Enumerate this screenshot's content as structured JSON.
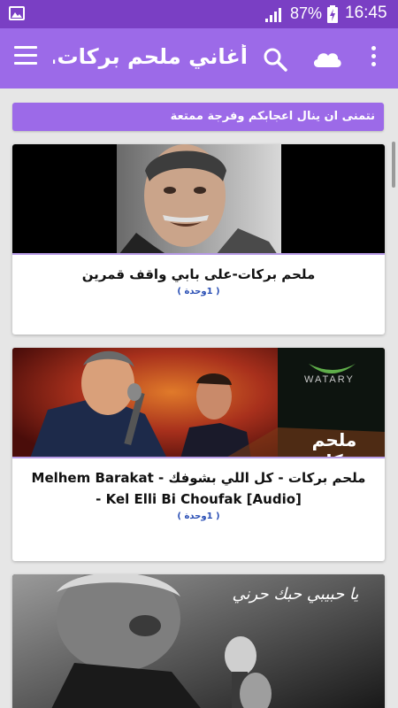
{
  "status_bar": {
    "battery_percent": "87%",
    "time": "16:45",
    "icons": [
      "gallery-icon",
      "signal-icon",
      "battery-charging-icon"
    ]
  },
  "app_bar": {
    "title": "أغاني ملحم بركات...",
    "icons": [
      "menu-icon",
      "search-icon",
      "cloud-icon",
      "more-vert-icon"
    ]
  },
  "banner": {
    "text": "نتمنى ان ينال اعجابكم وفرجة ممتعة"
  },
  "cards": [
    {
      "title": "ملحم بركات-على بابي واقف قمرين",
      "unit": "( 1وحدة )"
    },
    {
      "title": "ملحم بركات - كل اللي بشوفك Melhem Barakat - Kel Elli Bi Choufak [Audio] -",
      "unit": "( 1وحدة )",
      "thumb_overlay_brand": "WATARY",
      "thumb_overlay_name": "ملحم بركات"
    },
    {
      "thumb_overlay_text": "يا حبيبي حبك حرني"
    }
  ],
  "colors": {
    "status_bar": "#7a3fc4",
    "app_bar": "#9c6ae8",
    "banner": "#9c6ae8",
    "unit_text": "#2a4fb5",
    "background": "#e6e6e6"
  }
}
